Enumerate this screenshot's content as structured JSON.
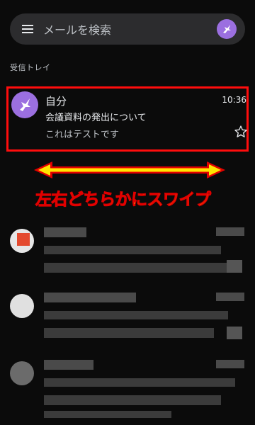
{
  "search": {
    "placeholder": "メールを検索"
  },
  "inbox": {
    "label": "受信トレイ"
  },
  "mail": {
    "sender": "自分",
    "time": "10:36",
    "subject": "会議資料の発出について",
    "preview": "これはテストです"
  },
  "annotation": {
    "caption": "左右どちらかにスワイプ"
  },
  "colors": {
    "accent": "#9b6fe0",
    "highlight": "#ff0d0d",
    "caption": "#ffe500"
  }
}
